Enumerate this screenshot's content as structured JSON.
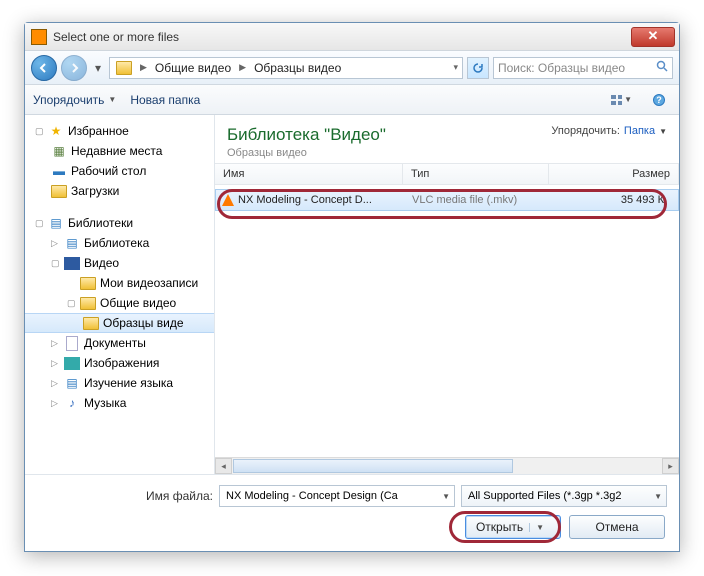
{
  "window": {
    "title": "Select one or more files"
  },
  "nav": {
    "path_segments": [
      "Общие видео",
      "Образцы видео"
    ],
    "search_placeholder": "Поиск: Образцы видео"
  },
  "toolbar": {
    "organize": "Упорядочить",
    "newfolder": "Новая папка"
  },
  "tree": {
    "favorites": "Избранное",
    "recent": "Недавние места",
    "desktop": "Рабочий стол",
    "downloads": "Загрузки",
    "libraries": "Библиотеки",
    "library": "Библиотека",
    "video": "Видео",
    "myvideos": "Мои видеозаписи",
    "sharedvideo": "Общие видео",
    "samplesvideo": "Образцы виде",
    "documents": "Документы",
    "images": "Изображения",
    "languagestudy": "Изучение языка",
    "music": "Музыка"
  },
  "library_header": {
    "title": "Библиотека \"Видео\"",
    "subtitle": "Образцы видео",
    "arrange_label": "Упорядочить:",
    "arrange_value": "Папка"
  },
  "columns": {
    "name": "Имя",
    "type": "Тип",
    "size": "Размер"
  },
  "files": [
    {
      "name": "NX Modeling - Concept D...",
      "type": "VLC media file (.mkv)",
      "size": "35 493 К"
    }
  ],
  "footer": {
    "filename_label": "Имя файла:",
    "filename_value": "NX Modeling - Concept Design (Cа",
    "filter_value": "All Supported Files (*.3gp *.3g2",
    "open": "Открыть",
    "cancel": "Отмена"
  }
}
